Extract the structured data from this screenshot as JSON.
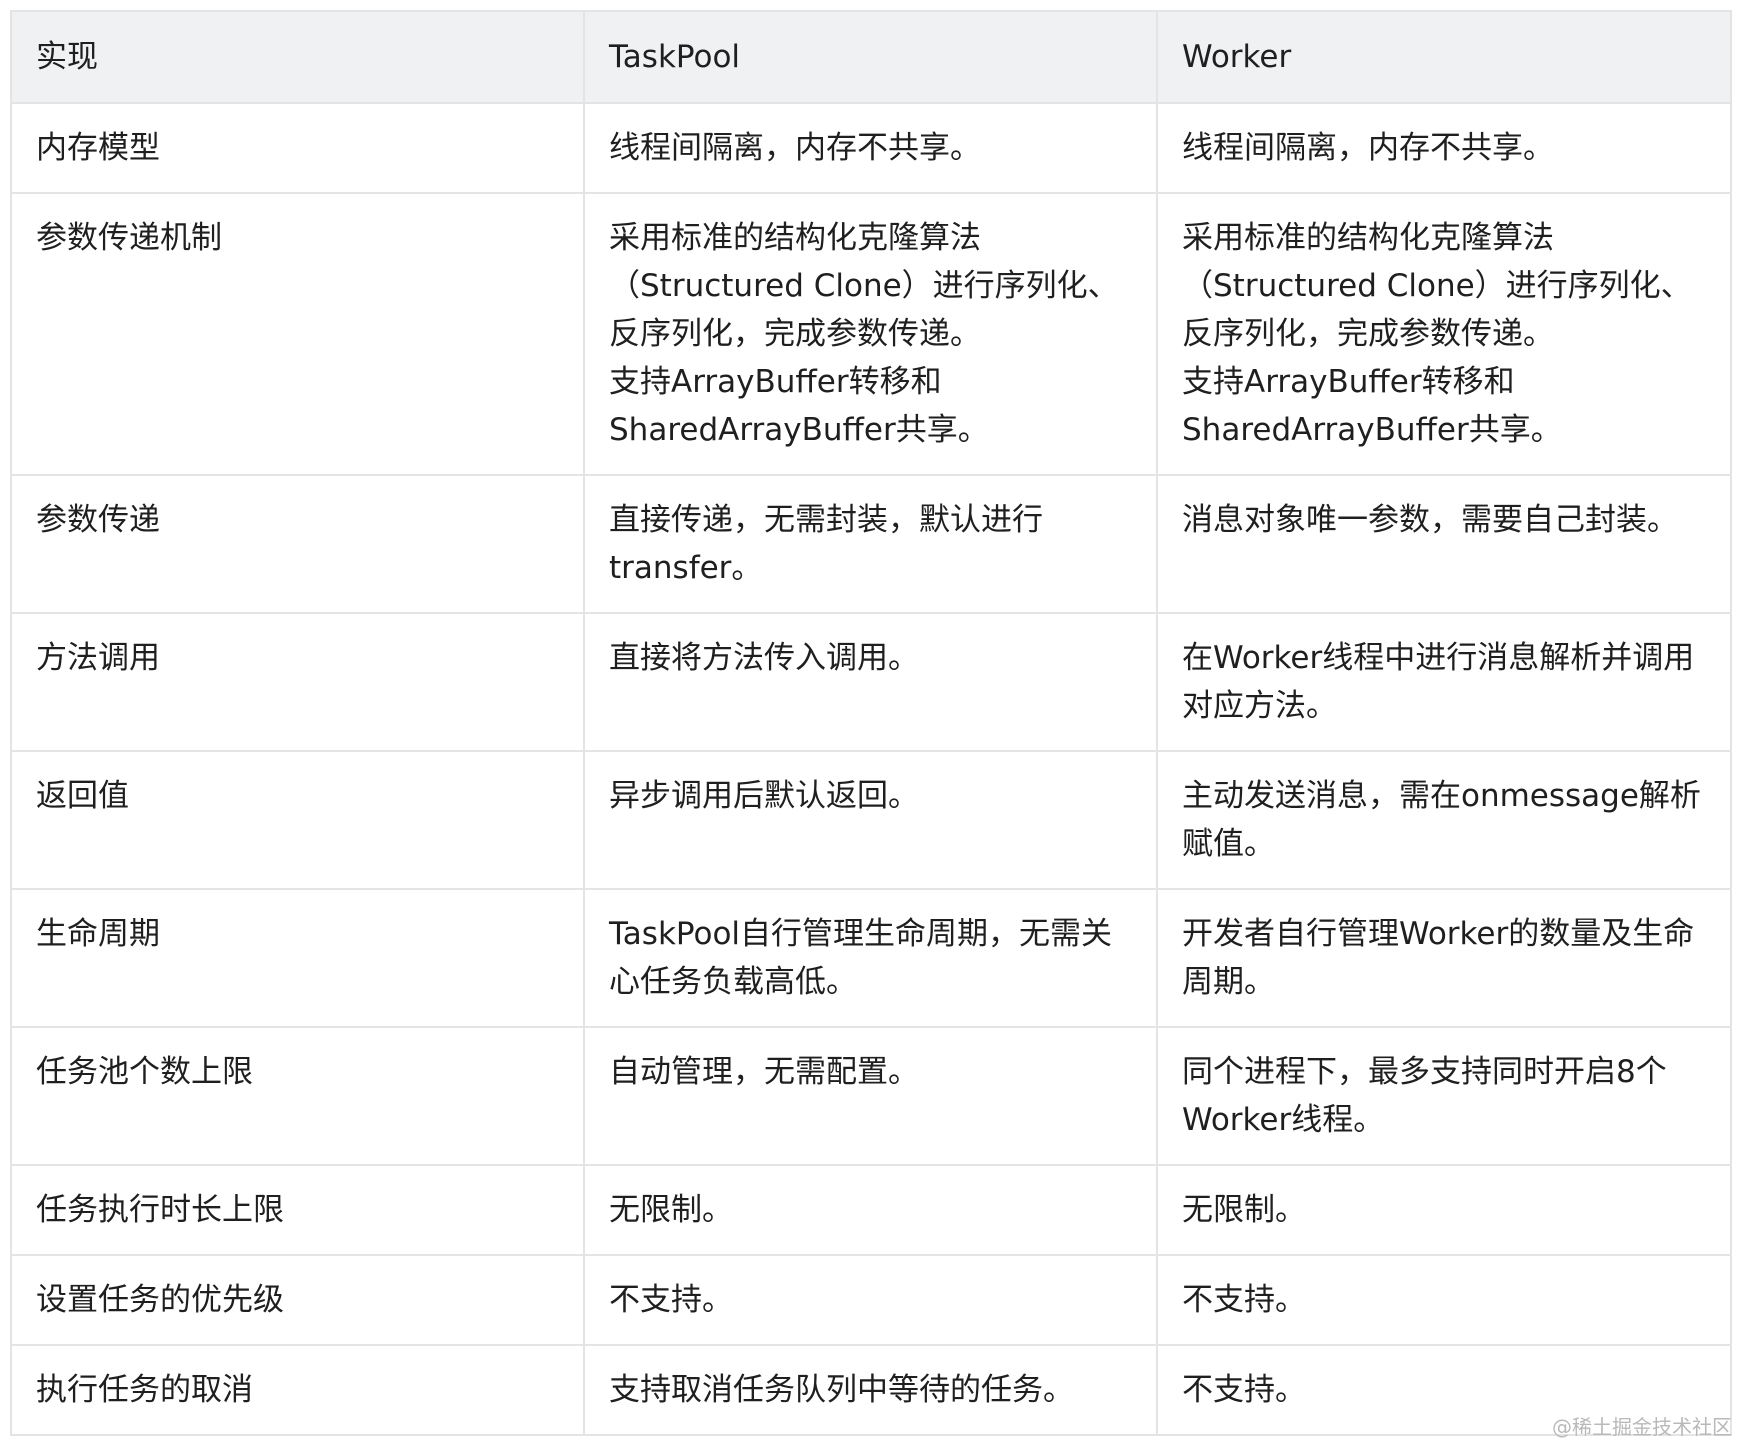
{
  "table": {
    "headers": [
      "实现",
      "TaskPool",
      "Worker"
    ],
    "rows": [
      {
        "feature": [
          "内存模型"
        ],
        "taskpool": [
          "线程间隔离，内存不共享。"
        ],
        "worker": [
          "线程间隔离，内存不共享。"
        ]
      },
      {
        "feature": [
          "参数传递机制"
        ],
        "taskpool": [
          "采用标准的结构化克隆算法",
          "（Structured Clone）进行序列化、",
          "反序列化，完成参数传递。",
          "支持ArrayBuffer转移和",
          "SharedArrayBuffer共享。"
        ],
        "worker": [
          "采用标准的结构化克隆算法",
          "（Structured Clone）进行序列化、",
          "反序列化，完成参数传递。",
          "支持ArrayBuffer转移和",
          "SharedArrayBuffer共享。"
        ]
      },
      {
        "feature": [
          "参数传递"
        ],
        "taskpool": [
          "直接传递，无需封装，默认进行",
          "transfer。"
        ],
        "worker": [
          "消息对象唯一参数，需要自己封装。"
        ]
      },
      {
        "feature": [
          "方法调用"
        ],
        "taskpool": [
          "直接将方法传入调用。"
        ],
        "worker": [
          "在Worker线程中进行消息解析并调用",
          "对应方法。"
        ]
      },
      {
        "feature": [
          "返回值"
        ],
        "taskpool": [
          "异步调用后默认返回。"
        ],
        "worker": [
          "主动发送消息，需在onmessage解析",
          "赋值。"
        ]
      },
      {
        "feature": [
          "生命周期"
        ],
        "taskpool": [
          "TaskPool自行管理生命周期，无需关",
          "心任务负载高低。"
        ],
        "worker": [
          "开发者自行管理Worker的数量及生命",
          "周期。"
        ]
      },
      {
        "feature": [
          "任务池个数上限"
        ],
        "taskpool": [
          "自动管理，无需配置。"
        ],
        "worker": [
          "同个进程下，最多支持同时开启8个",
          "Worker线程。"
        ]
      },
      {
        "feature": [
          "任务执行时长上限"
        ],
        "taskpool": [
          "无限制。"
        ],
        "worker": [
          "无限制。"
        ]
      },
      {
        "feature": [
          "设置任务的优先级"
        ],
        "taskpool": [
          "不支持。"
        ],
        "worker": [
          "不支持。"
        ]
      },
      {
        "feature": [
          "执行任务的取消"
        ],
        "taskpool": [
          "支持取消任务队列中等待的任务。"
        ],
        "worker": [
          "不支持。"
        ]
      }
    ]
  },
  "watermark": "@稀土掘金技术社区"
}
